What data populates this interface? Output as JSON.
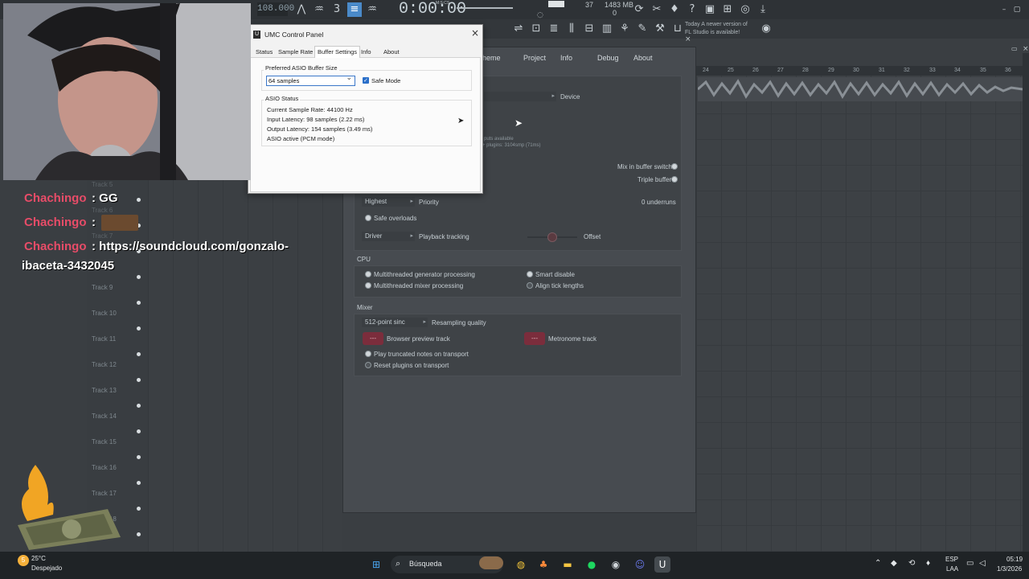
{
  "daw": {
    "tempo": "108.000",
    "time": "0:00:00",
    "time_suffix": "M:S:CS",
    "voices": "37",
    "memory": "1483 MB",
    "memory_sub": "0",
    "news_line1": "Today  A newer version of",
    "news_line2": "FL Studio is available!"
  },
  "settings": {
    "tabs": [
      "heme",
      "Project",
      "Info",
      "Debug",
      "About"
    ],
    "device_label": "Device",
    "inputs_available": "puts available",
    "plugins_latency": "+ plugins: 3104smp (71ms)",
    "mix_in_buffer_switch": "Mix in buffer switch",
    "triple_buffer": "Triple buffer",
    "priority_value": "Highest",
    "priority_label": "Priority",
    "underruns": "0 underruns",
    "safe_overloads": "Safe overloads",
    "playback_value": "Driver",
    "playback_label": "Playback tracking",
    "offset_label": "Offset",
    "cpu_title": "CPU",
    "cpu_multi_gen": "Multithreaded generator processing",
    "cpu_multi_mix": "Multithreaded mixer processing",
    "cpu_smart_disable": "Smart disable",
    "cpu_align_tick": "Align tick lengths",
    "mixer_title": "Mixer",
    "resampling_value": "512-point sinc",
    "resampling_label": "Resampling quality",
    "browser_preview_btn": "---",
    "browser_preview_label": "Browser preview track",
    "metronome_btn": "---",
    "metronome_label": "Metronome track",
    "play_truncated": "Play truncated notes on transport",
    "reset_plugins": "Reset plugins on transport"
  },
  "umc": {
    "title": "UMC Control Panel",
    "tabs": [
      "Status",
      "Sample Rate",
      "Buffer Settings",
      "Info",
      "About"
    ],
    "active_tab": "Buffer Settings",
    "buffer_group_label": "Preferred ASIO Buffer Size",
    "buffer_value": "64 samples",
    "safe_mode_label": "Safe Mode",
    "safe_mode_checked": true,
    "status_group_label": "ASIO Status",
    "sample_rate": "Current Sample Rate: 44100 Hz",
    "input_latency": "Input Latency: 98 samples (2.22 ms)",
    "output_latency": "Output Latency: 154 samples (3.49 ms)",
    "asio_state": "ASIO active (PCM mode)"
  },
  "tracks": [
    "Track 9",
    "Track 10",
    "Track 11",
    "Track 12",
    "Track 13",
    "Track 14",
    "Track 15",
    "Track 16",
    "Track 17",
    "Track 18"
  ],
  "tracks_faded": [
    "Track 5",
    "Track 6",
    "Track 7"
  ],
  "ruler": [
    "24",
    "25",
    "26",
    "27",
    "28",
    "29",
    "30",
    "31",
    "32",
    "33",
    "34",
    "35",
    "36"
  ],
  "chat": [
    {
      "user": "Chachingo",
      "text": ": GG"
    },
    {
      "user": "Chachingo",
      "text": ":"
    },
    {
      "user": "Chachingo",
      "text": ": https://soundcloud.com/gonzalo-",
      "cont": "ibaceta-3432045"
    }
  ],
  "weather": {
    "temp": "25°C",
    "desc": "Despejado",
    "badge": "5"
  },
  "taskbar": {
    "search_placeholder": "Búsqueda",
    "lang": "ESP",
    "layout": "LAA",
    "time": "05:19",
    "date": "1/3/2026"
  },
  "colors": {
    "accent_red": "#7b2d3c",
    "chat_name": "#e74c68",
    "umc_accent": "#2a6fc9"
  }
}
